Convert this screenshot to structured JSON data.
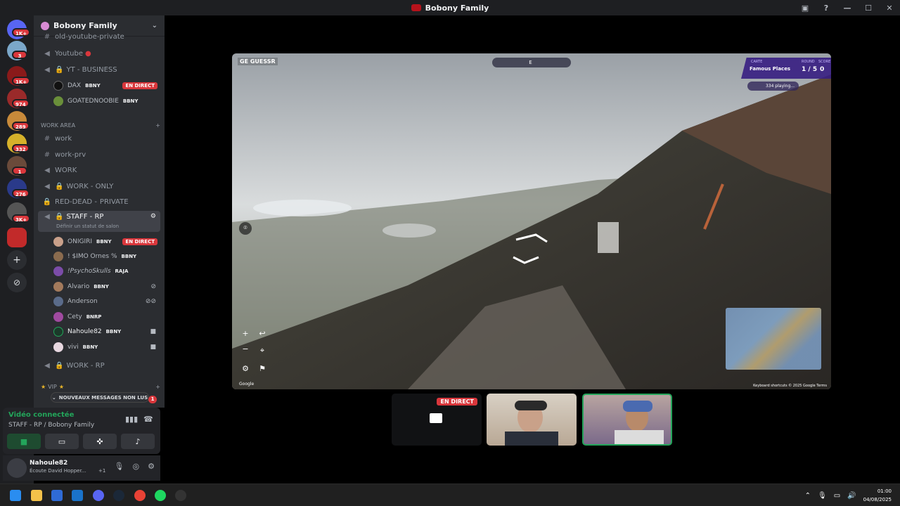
{
  "window": {
    "title": "Bobony Family"
  },
  "servers": {
    "badges": [
      "1K+",
      "3",
      "1K+",
      "974",
      "289",
      "332",
      "1",
      "276",
      "3K+"
    ]
  },
  "guild": {
    "name": "Bobony Family"
  },
  "channels": {
    "top_partial": "old-youtube-private",
    "youtube": "Youtube",
    "yt_business": "YT - BUSINESS",
    "work_area_cat": "WORK AREA",
    "work": "work",
    "work_prv": "work-prv",
    "work0": "WORK",
    "work_only": "WORK - ONLY",
    "red_dead": "RED-DEAD -",
    "red_dead_suffix": "PRIVATE",
    "staff_rp": "STAFF - RP",
    "staff_sub": "Définir un statut de salon",
    "work_rp": "WORK - RP",
    "vip_cat": "VIP"
  },
  "users_top": [
    {
      "name": "DAX",
      "tag": "BBNY",
      "live": "EN DIRECT",
      "avatar": "#111"
    },
    {
      "name": "GOATEDNOOBIE",
      "tag": "BBNY",
      "avatar": "#6a8f3a"
    }
  ],
  "users_staff": [
    {
      "name": "ONIGIRI",
      "tag": "BBNY",
      "live": "EN DIRECT",
      "avatar": "#c9a08a"
    },
    {
      "name": "! $IMO Ornes %",
      "tag": "BBNY",
      "avatar": "#8a6b4e"
    },
    {
      "name": "!PsychoSkulls",
      "tag": "RAJA",
      "avatar": "#7b4ca8"
    },
    {
      "name": "Alvario",
      "tag": "BBNY",
      "avatar": "#a37a5c"
    },
    {
      "name": "Anderson",
      "tag": "",
      "avatar": "#5a6b8a"
    },
    {
      "name": "Cety",
      "tag": "BNRP",
      "avatar": "#a04aa0"
    },
    {
      "name": "Nahoule82",
      "tag": "BBNY",
      "avatar": "#1b3a2a"
    },
    {
      "name": "vivi",
      "tag": "BBNY",
      "avatar": "#e7d7e0"
    }
  ],
  "new_messages": "NOUVEAUX MESSAGES NON LUS",
  "new_messages_count": "1",
  "voice": {
    "status": "Vidéo connectée",
    "channel": "STAFF - RP / Bobony Family"
  },
  "user_panel": {
    "name": "Nahoule82",
    "status": "Écoute David Hopper...",
    "extra": "+1"
  },
  "game": {
    "logo": "GE GUESSR",
    "compass": "E",
    "map_label": "CARTE",
    "map_value": "Famous Places",
    "round_label": "ROUND",
    "round_value": "1 / 5",
    "score_label": "SCORE",
    "score_value": "0",
    "players": "334 playing...",
    "google": "Google",
    "footer": "Keyboard shortcuts   © 2025 Google   Terms"
  },
  "stream_tiles": {
    "live_label": "EN DIRECT"
  },
  "taskbar": {
    "time": "01:00",
    "date": "04/08/2025"
  }
}
